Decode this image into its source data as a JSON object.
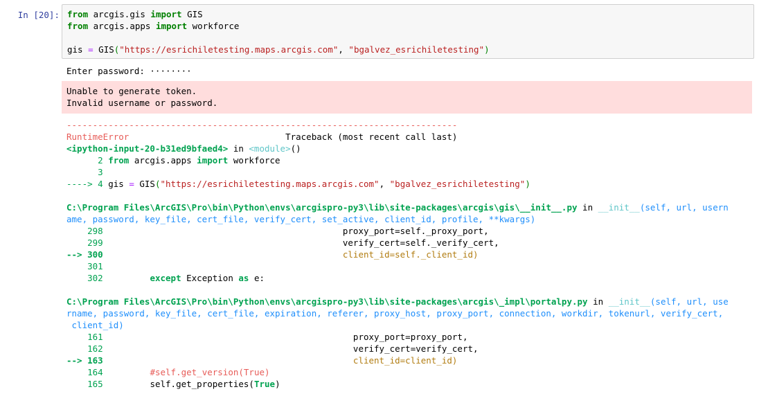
{
  "prompt": "In [20]:",
  "code": {
    "l1_kw1": "from",
    "l1_mod": " arcgis.gis ",
    "l1_kw2": "import",
    "l1_name": " GIS",
    "l2_kw1": "from",
    "l2_mod": " arcgis.apps ",
    "l2_kw2": "import",
    "l2_name": " workforce",
    "l4_var": "gis ",
    "l4_eq": "=",
    "l4_fn": " GIS",
    "l4_open": "(",
    "l4_arg1": "\"https://esrichiletesting.maps.arcgis.com\"",
    "l4_comma": ", ",
    "l4_arg2": "\"bgalvez_esrichiletesting\"",
    "l4_close": ")"
  },
  "stdout": "Enter password: ········",
  "stderr": {
    "line1": "Unable to generate token.",
    "line2": "Invalid username or password."
  },
  "traceback": {
    "dashes": "---------------------------------------------------------------------------",
    "error_name": "RuntimeError",
    "header_tail": "                              Traceback (most recent call last)",
    "frame1": {
      "file": "<ipython-input-20-b31ed9bfaed4>",
      "in": " in ",
      "func": "<module>",
      "args": "()",
      "l2_num": "      2 ",
      "l2_kw1": "from",
      "l2_mod": " arcgis.apps ",
      "l2_kw2": "import",
      "l2_name": " workforce",
      "l3_num": "      3",
      "arrow": "----> 4 ",
      "l4_var": "gis ",
      "l4_eq": "=",
      "l4_fn": " GIS",
      "l4_open": "(",
      "l4_arg1": "\"https://esrichiletesting.maps.arcgis.com\"",
      "l4_comma": ", ",
      "l4_arg2": "\"bgalvez_esrichiletesting\"",
      "l4_close": ")"
    },
    "frame2": {
      "path_a": "C:\\Program Files\\ArcGIS\\Pro\\bin\\Python\\envs\\arcgispro-py3\\lib\\site-packages\\arcgis\\gis\\__init__.py",
      "in": " in ",
      "func": "__init__",
      "sig_a": "(self, url, usern",
      "sig_b": "ame, password, key_file, cert_file, verify_cert, set_active, client_id, profile, **kwargs)",
      "n298": "    298 ",
      "c298": "                                             proxy_port=self._proxy_port,",
      "n299": "    299 ",
      "c299": "                                             verify_cert=self._verify_cert,",
      "arrow": "--> 300 ",
      "c300": "                                             client_id=self._client_id)",
      "n301": "    301",
      "n302": "    302 ",
      "c302_pad": "        ",
      "c302_kw1": "except",
      "c302_mid": " Exception ",
      "c302_kw2": "as",
      "c302_end": " e:"
    },
    "frame3": {
      "path_a": "C:\\Program Files\\ArcGIS\\Pro\\bin\\Python\\envs\\arcgispro-py3\\lib\\site-packages\\arcgis\\_impl\\portalpy.py",
      "in": " in ",
      "func": "__init__",
      "sig_a": "(self, url, use",
      "sig_b": "rname, password, key_file, cert_file, expiration, referer, proxy_host, proxy_port, connection, workdir, tokenurl, verify_cert,",
      "sig_c": " client_id)",
      "n161": "    161 ",
      "c161": "                                               proxy_port=proxy_port,",
      "n162": "    162 ",
      "c162": "                                               verify_cert=verify_cert,",
      "arrow": "--> 163 ",
      "c163": "                                               client_id=client_id)",
      "n164": "    164 ",
      "c164_pad": "        ",
      "c164": "#self.get_version(True)",
      "n165": "    165 ",
      "c165_pad": "        ",
      "c165_fn": "self.get_properties(",
      "c165_kw": "True",
      "c165_end": ")"
    }
  }
}
